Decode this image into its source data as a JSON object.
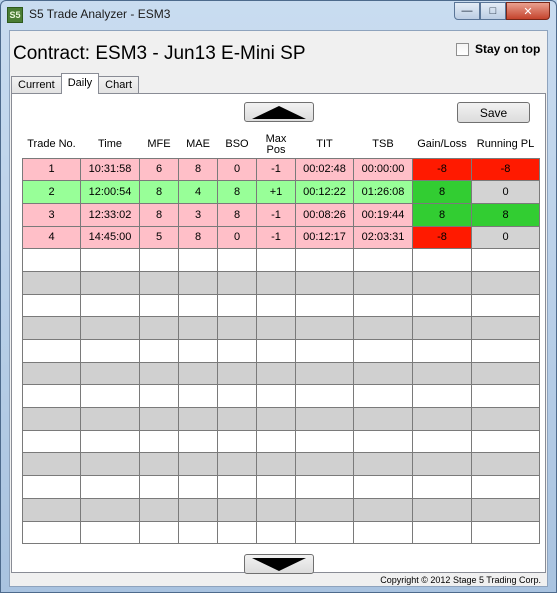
{
  "window": {
    "title": "S5 Trade Analyzer - ESM3",
    "icon_text": "S5",
    "min_glyph": "—",
    "max_glyph": "□",
    "close_glyph": "✕"
  },
  "header": {
    "contract_title": "Contract: ESM3 - Jun13 E-Mini SP",
    "stay_on_top_label": "Stay on top",
    "stay_on_top_checked": false
  },
  "tabs": [
    {
      "label": "Current",
      "active": false
    },
    {
      "label": "Daily",
      "active": true
    },
    {
      "label": "Chart",
      "active": false
    }
  ],
  "toolbar": {
    "save_label": "Save"
  },
  "table": {
    "columns": [
      "Trade No.",
      "Time",
      "MFE",
      "MAE",
      "BSO",
      "Max Pos",
      "TIT",
      "TSB",
      "Gain/Loss",
      "Running PL"
    ],
    "rows": [
      {
        "trade_no": "1",
        "time": "10:31:58",
        "mfe": "6",
        "mae": "8",
        "bso": "0",
        "max_pos": "-1",
        "tit": "00:02:48",
        "tsb": "00:00:00",
        "gain_loss": "-8",
        "running_pl": "-8",
        "row_color": "red",
        "gl_color": "red",
        "pl_color": "red"
      },
      {
        "trade_no": "2",
        "time": "12:00:54",
        "mfe": "8",
        "mae": "4",
        "bso": "8",
        "max_pos": "+1",
        "tit": "00:12:22",
        "tsb": "01:26:08",
        "gain_loss": "8",
        "running_pl": "0",
        "row_color": "green",
        "gl_color": "green",
        "pl_color": "gray"
      },
      {
        "trade_no": "3",
        "time": "12:33:02",
        "mfe": "8",
        "mae": "3",
        "bso": "8",
        "max_pos": "-1",
        "tit": "00:08:26",
        "tsb": "00:19:44",
        "gain_loss": "8",
        "running_pl": "8",
        "row_color": "red",
        "gl_color": "green",
        "pl_color": "green"
      },
      {
        "trade_no": "4",
        "time": "14:45:00",
        "mfe": "5",
        "mae": "8",
        "bso": "0",
        "max_pos": "-1",
        "tit": "00:12:17",
        "tsb": "02:03:31",
        "gain_loss": "-8",
        "running_pl": "0",
        "row_color": "red",
        "gl_color": "red",
        "pl_color": "gray"
      }
    ],
    "empty_rows": 13
  },
  "footer": {
    "copyright": "Copyright © 2012 Stage 5 Trading Corp."
  },
  "colors": {
    "row_red": "#ffbfc8",
    "row_green": "#98ff98",
    "cell_red": "#ff1a00",
    "cell_green": "#32cd32",
    "cell_gray": "#d3d3d3"
  }
}
